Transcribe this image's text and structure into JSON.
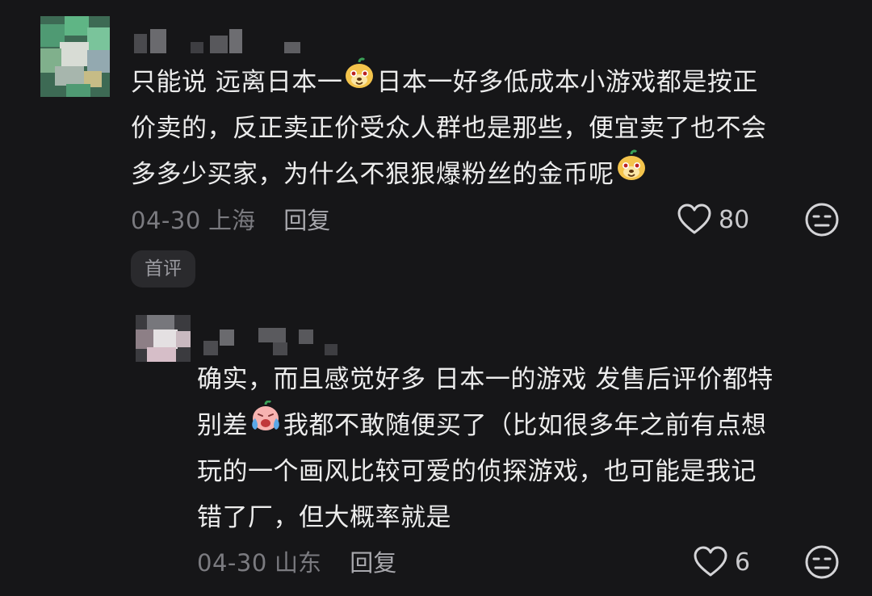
{
  "comments": [
    {
      "body_lines": [
        "只能说 远离日本一",
        "日本一好多低成本小游戏都是按正",
        "价卖的，反正卖正价受众人群也是那些，便宜卖了也不会",
        "多多少买家，为什么不狠狠爆粉丝的金币呢"
      ],
      "emojis": [
        "dog-face-emoji",
        "dog-face-emoji"
      ],
      "date": "04-30",
      "location": "上海",
      "reply_label": "回复",
      "like_count": "80",
      "badge": "首评"
    },
    {
      "body_lines": [
        "确实，而且感觉好多 日本一的游戏 发售后评价都特",
        "别差",
        "我都不敢随便买了（比如很多年之前有点想",
        "玩的一个画风比较可爱的侦探游戏，也可能是我记",
        "错了厂，但大概率就是"
      ],
      "emojis": [
        "crying-face-emoji"
      ],
      "date": "04-30",
      "location": "山东",
      "reply_label": "回复",
      "like_count": "6"
    }
  ],
  "colors": {
    "background": "#161618",
    "text": "#ececec",
    "meta": "#7b7b80",
    "badge_bg": "#2a2a2d"
  },
  "icons": [
    "heart-icon",
    "meh-face-icon"
  ]
}
